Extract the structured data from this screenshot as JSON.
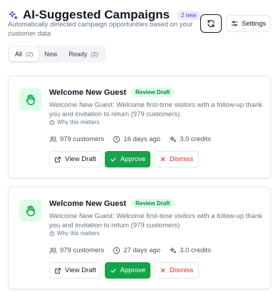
{
  "header": {
    "title": "AI-Suggested Campaigns",
    "new_badge": "2 new",
    "subtitle": "Automatically detected campaign opportunities based on your customer data",
    "settings_label": "Settings"
  },
  "tabs": [
    {
      "label": "All",
      "count": "(2)"
    },
    {
      "label": "New",
      "count": ""
    },
    {
      "label": "Ready",
      "count": "(2)"
    }
  ],
  "cards": [
    {
      "title": "Welcome New Guest",
      "status": "Review Draft",
      "description": "Welcome New Guest: Welcome first-time visitors with a follow-up thank you and invitation to return (979 customers)",
      "why": "Why this matters",
      "customers": "979 customers",
      "age": "16 days ago",
      "credits": "3.0 credits",
      "view_label": "View Draft",
      "approve_label": "Approve",
      "dismiss_label": "Dismiss"
    },
    {
      "title": "Welcome New Guest",
      "status": "Review Draft",
      "description": "Welcome New Guest: Welcome first-time visitors with a follow-up thank you and invitation to return (979 customers)",
      "why": "Why this matters",
      "customers": "979 customers",
      "age": "27 days ago",
      "credits": "3.0 credits",
      "view_label": "View Draft",
      "approve_label": "Approve",
      "dismiss_label": "Dismiss"
    }
  ],
  "colors": {
    "accent_purple": "#7c3aed",
    "success_green": "#16a34a",
    "danger_red": "#dc2626"
  },
  "icons": {
    "title": "sparkles-icon",
    "refresh": "refresh-icon",
    "settings": "sliders-icon",
    "card": "waving-hand-icon",
    "why": "info-icon",
    "customers": "users-icon",
    "age": "clock-icon",
    "credits": "sparkle-icon",
    "view": "external-link-icon",
    "approve": "check-icon",
    "dismiss": "x-icon"
  }
}
